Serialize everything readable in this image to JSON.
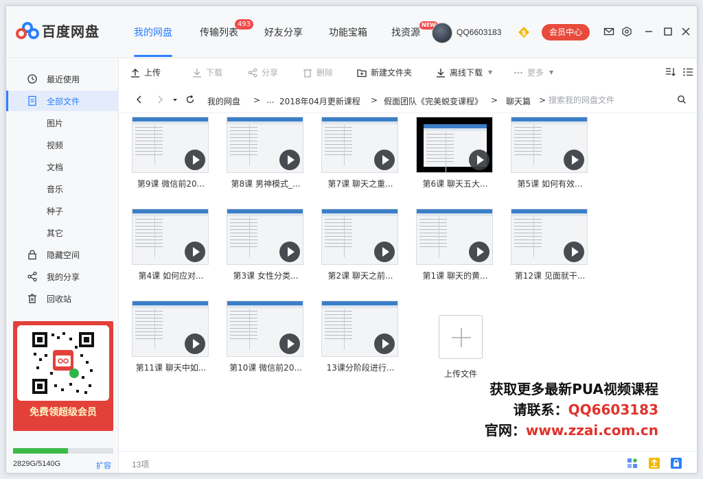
{
  "app": {
    "title": "百度网盘",
    "nav_tabs": [
      {
        "label": "我的网盘"
      },
      {
        "label": "传输列表",
        "badge": "493"
      },
      {
        "label": "好友分享"
      },
      {
        "label": "功能宝箱"
      },
      {
        "label": "找资源",
        "badge": "NEW"
      }
    ],
    "username": "QQ6603183",
    "vip_button": "会员中心"
  },
  "sidebar": {
    "items": [
      {
        "label": "最近使用",
        "icon": "clock-icon"
      },
      {
        "label": "全部文件",
        "icon": "file-icon"
      },
      {
        "label": "图片"
      },
      {
        "label": "视频"
      },
      {
        "label": "文档"
      },
      {
        "label": "音乐"
      },
      {
        "label": "种子"
      },
      {
        "label": "其它"
      },
      {
        "label": "隐藏空间",
        "icon": "lock-icon"
      },
      {
        "label": "我的分享",
        "icon": "share-icon"
      },
      {
        "label": "回收站",
        "icon": "trash-icon"
      }
    ],
    "promo_text": "免费领超级会员",
    "storage_used_ratio": 0.55,
    "storage_text": "2829G/5140G",
    "expand_label": "扩容"
  },
  "toolbar": {
    "upload": "上传",
    "download": "下载",
    "share": "分享",
    "delete": "删除",
    "new_folder": "新建文件夹",
    "offline_download": "离线下载",
    "more": "更多"
  },
  "breadcrumb": {
    "items": [
      "我的网盘",
      "...",
      "2018年04月更新课程",
      "假面团队《完美蜕变课程》",
      "聊天篇"
    ],
    "search_placeholder": "搜索我的网盘文件"
  },
  "files": [
    {
      "name": "第9课 微信前20..."
    },
    {
      "name": "第8课 男神模式_..."
    },
    {
      "name": "第7课 聊天之重..."
    },
    {
      "name": "第6课 聊天五大..."
    },
    {
      "name": "第5课 如何有效..."
    },
    {
      "name": "第4课 如何应对..."
    },
    {
      "name": "第3课 女性分类..."
    },
    {
      "name": "第2课 聊天之前..."
    },
    {
      "name": "第1课 聊天的黄..."
    },
    {
      "name": "第12课 见面就干..."
    },
    {
      "name": "第11课 聊天中如..."
    },
    {
      "name": "第10课 微信前20..."
    },
    {
      "name": "13课分阶段进行..."
    }
  ],
  "upload_tile_label": "上传文件",
  "watermark": {
    "line1": "获取更多最新PUA视频课程",
    "line2_prefix": "请联系：",
    "line2_value": "QQ6603183",
    "line3_prefix": "官网：",
    "line3_value": "www.zzai.com.cn"
  },
  "footer": {
    "count": "13项"
  },
  "colors": {
    "accent": "#2b7fff",
    "vip": "#e84a3b",
    "storage": "#3cba4a"
  }
}
